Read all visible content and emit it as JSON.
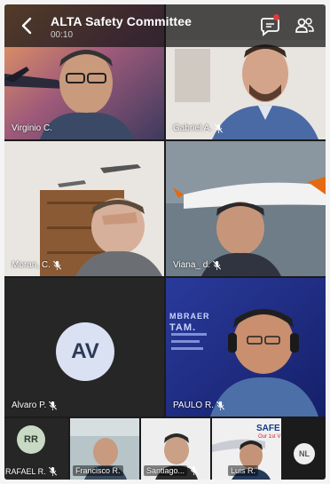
{
  "header": {
    "title": "ALTA Safety Committee",
    "timer": "00:10",
    "icons": {
      "back": "chevron-left-icon",
      "chat": "chat-bubble-icon",
      "participants": "people-icon"
    }
  },
  "participants": [
    {
      "name": "Virginio C.",
      "muted": false
    },
    {
      "name": "Gabriel A.",
      "muted": true
    },
    {
      "name": "Moran, C.",
      "muted": true
    },
    {
      "name": "Viana_ d.",
      "muted": true
    },
    {
      "name": "Alvaro P.",
      "muted": true,
      "initials": "AV"
    },
    {
      "name": "PAULO R.",
      "muted": true
    }
  ],
  "strip": [
    {
      "name": "RAFAEL R.",
      "muted": true,
      "initials": "RR"
    },
    {
      "name": "Francisco R.",
      "muted": false
    },
    {
      "name": "Santiago...",
      "muted": true
    },
    {
      "name": "Luis R.",
      "muted": false
    }
  ],
  "overflow": {
    "initials": "NL"
  },
  "backgrounds": {
    "embraer_label": "MBRAER",
    "tam_label": "TAM.",
    "safe_label": "SAFE",
    "safe_sub": "Our 1st V"
  },
  "colors": {
    "header_bg": "#141414",
    "notification_dot": "#e53935",
    "avatar_av": "#d9e1f2",
    "avatar_rr": "#c8d9c4",
    "avatar_nl": "#eeeeee",
    "tile_dark": "#262626"
  }
}
